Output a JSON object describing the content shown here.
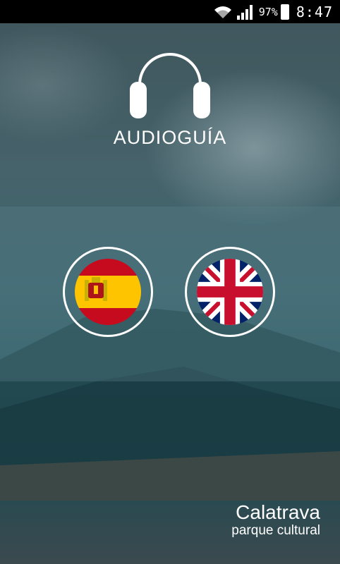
{
  "status_bar": {
    "battery": "97%",
    "time": "8:47",
    "icons": [
      "wifi-icon",
      "signal-icon",
      "battery-icon"
    ]
  },
  "header": {
    "icon": "headphones-icon",
    "title": "AUDIOGUÍA"
  },
  "languages": [
    {
      "code": "es",
      "icon": "spain-flag-icon"
    },
    {
      "code": "en",
      "icon": "uk-flag-icon"
    }
  ],
  "brand": {
    "name": "Calatrava",
    "subtitle": "parque cultural"
  },
  "colors": {
    "flag_es_red": "#c60b1e",
    "flag_es_yellow": "#ffc400",
    "flag_uk_blue": "#012169",
    "flag_uk_red": "#c8102e"
  }
}
